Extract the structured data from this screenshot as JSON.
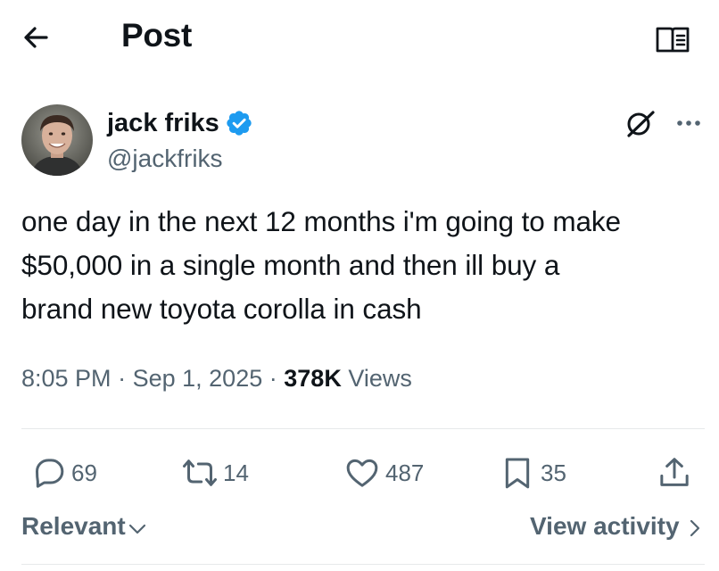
{
  "header": {
    "title": "Post"
  },
  "author": {
    "name": "jack friks",
    "handle": "@jackfriks",
    "verified": true
  },
  "post": {
    "lines": [
      "one day in the next 12 months i'm going to make",
      "$50,000 in a single month and then ill buy a",
      "brand new toyota corolla in cash"
    ],
    "time": "8:05 PM",
    "date": "Sep 1, 2025",
    "views_count": "378K",
    "views_label": "Views",
    "separator": "·"
  },
  "actions": {
    "replies": "69",
    "reposts": "14",
    "likes": "487",
    "bookmarks": "35"
  },
  "footer": {
    "sort_label": "Relevant",
    "activity_label": "View activity"
  },
  "icons": {
    "back": "arrow-left-icon",
    "reader": "reader-mode-icon",
    "grok": "grok-icon",
    "more": "more-icon",
    "verified": "verified-badge-icon",
    "reply": "reply-icon",
    "repost": "repost-icon",
    "like": "heart-icon",
    "bookmark": "bookmark-icon",
    "share": "share-icon"
  },
  "colors": {
    "verified": "#1d9bf0",
    "secondary_text": "#536471",
    "primary_text": "#0f1419"
  }
}
